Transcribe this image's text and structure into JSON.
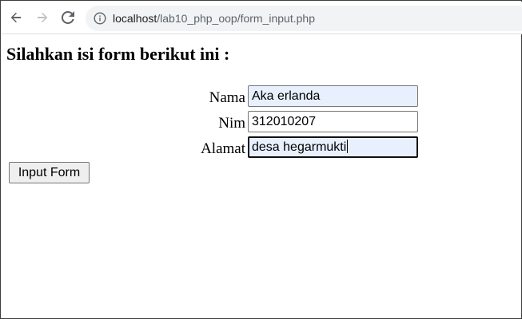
{
  "browser": {
    "url_host": "localhost",
    "url_path": "/lab10_php_oop/form_input.php",
    "icons": [
      "back-arrow-icon",
      "forward-arrow-icon",
      "reload-icon",
      "info-icon"
    ]
  },
  "page": {
    "heading": "Silahkan isi form berikut ini :",
    "form": {
      "fields": [
        {
          "label": "Nama",
          "value": "Aka erlanda"
        },
        {
          "label": "Nim",
          "value": "312010207"
        },
        {
          "label": "Alamat",
          "value": "desa hegarmukti"
        }
      ],
      "submit_label": "Input Form"
    }
  },
  "colors": {
    "autofill_bg": "#e8f0fe",
    "omnibox_bg": "#f1f3f4",
    "button_bg": "#efefef"
  }
}
